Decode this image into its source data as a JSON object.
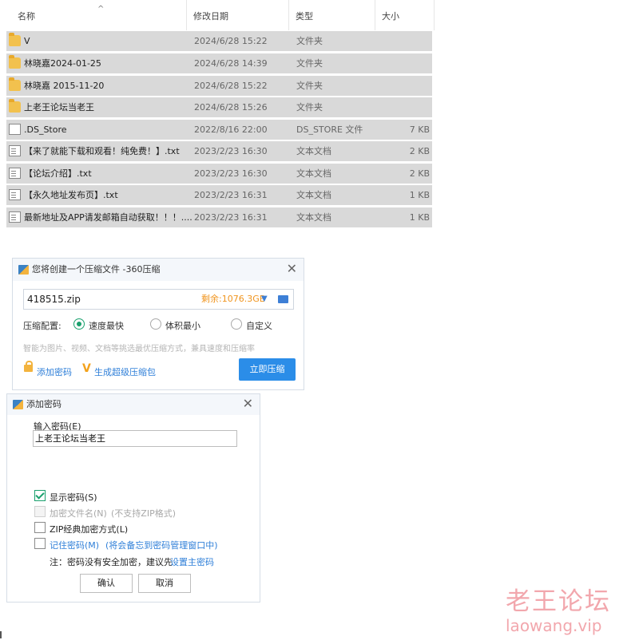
{
  "file_list": {
    "headers": {
      "name": "名称",
      "date": "修改日期",
      "type": "类型",
      "size": "大小"
    },
    "rows": [
      {
        "icon": "folder-icon",
        "name": "V",
        "date": "2024/6/28 15:22",
        "type": "文件夹",
        "size": ""
      },
      {
        "icon": "folder-icon",
        "name": "林晓嘉2024-01-25",
        "date": "2024/6/28 14:39",
        "type": "文件夹",
        "size": ""
      },
      {
        "icon": "folder-icon",
        "name": "林晓嘉 2015-11-20",
        "date": "2024/6/28 15:22",
        "type": "文件夹",
        "size": ""
      },
      {
        "icon": "folder-icon",
        "name": "上老王论坛当老王",
        "date": "2024/6/28 15:26",
        "type": "文件夹",
        "size": ""
      },
      {
        "icon": "file-icon",
        "name": ".DS_Store",
        "date": "2022/8/16 22:00",
        "type": "DS_STORE 文件",
        "size": "7 KB"
      },
      {
        "icon": "text-file-icon",
        "name": "【来了就能下载和观看！纯免费！】.txt",
        "date": "2023/2/23 16:30",
        "type": "文本文档",
        "size": "2 KB"
      },
      {
        "icon": "text-file-icon",
        "name": "【论坛介绍】.txt",
        "date": "2023/2/23 16:30",
        "type": "文本文档",
        "size": "2 KB"
      },
      {
        "icon": "text-file-icon",
        "name": "【永久地址发布页】.txt",
        "date": "2023/2/23 16:31",
        "type": "文本文档",
        "size": "1 KB"
      },
      {
        "icon": "text-file-icon",
        "name": "最新地址及APP请发邮箱自动获取！！！....",
        "date": "2023/2/23 16:31",
        "type": "文本文档",
        "size": "1 KB"
      }
    ]
  },
  "compress_dialog": {
    "title": "您将创建一个压缩文件 -360压缩",
    "filename": "418515.zip",
    "free_space": "剩余:1076.3GB",
    "config_label": "压缩配置:",
    "options": [
      "速度最快",
      "体积最小",
      "自定义"
    ],
    "selected_option": "速度最快",
    "hint": "智能为图片、视频、文档等挑选最优压缩方式，兼具速度和压缩率",
    "add_password": "添加密码",
    "super_pack": "生成超级压缩包",
    "compress_button": "立即压缩",
    "accent_color": "#2b8de8"
  },
  "password_dialog": {
    "title": "添加密码",
    "input_label": "输入密码(E)",
    "password_value": "上老王论坛当老王",
    "show_password": {
      "label": "显示密码(S)",
      "checked": true
    },
    "encrypt_names": {
      "label": "加密文件名(N)",
      "note": "(不支持ZIP格式)",
      "disabled": true
    },
    "zip_classic": {
      "label": "ZIP经典加密方式(L)",
      "checked": false
    },
    "remember": {
      "label": "记住密码(M)",
      "note": "(将会备忘到密码管理窗口中)",
      "checked": false
    },
    "notice_prefix": "注：密码没有安全加密，建议先",
    "notice_link": "设置主密码",
    "ok_button": "确认",
    "cancel_button": "取消"
  },
  "watermark": {
    "line1": "老王论坛",
    "line2": "laowang.vip"
  }
}
